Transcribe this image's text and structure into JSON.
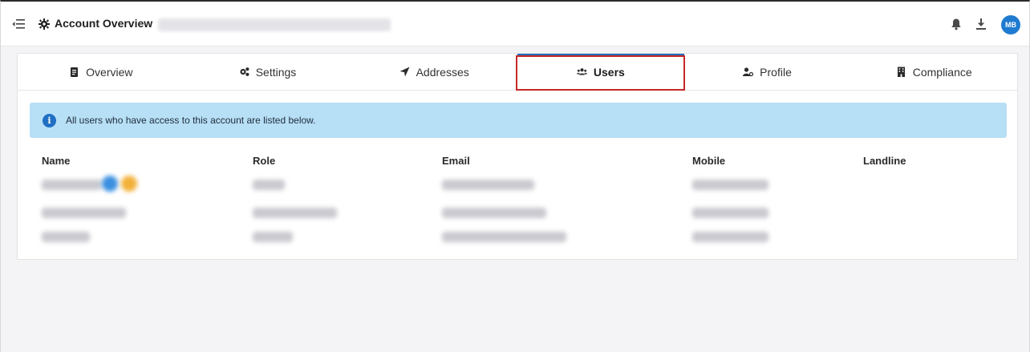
{
  "header": {
    "title": "Account Overview",
    "avatar_initials": "MB",
    "icons": [
      "menu-collapse-icon",
      "gear-icon",
      "bell-icon",
      "download-icon"
    ]
  },
  "tabs": [
    {
      "label": "Overview",
      "icon": "clipboard-icon"
    },
    {
      "label": "Settings",
      "icon": "cogs-icon"
    },
    {
      "label": "Addresses",
      "icon": "location-arrow-icon"
    },
    {
      "label": "Users",
      "icon": "users-icon",
      "active": true
    },
    {
      "label": "Profile",
      "icon": "user-profile-icon"
    },
    {
      "label": "Compliance",
      "icon": "building-icon"
    }
  ],
  "info": {
    "text": "All users who have access to this account are listed below."
  },
  "table": {
    "columns": [
      "Name",
      "Role",
      "Email",
      "Mobile",
      "Landline"
    ]
  },
  "colors": {
    "accent": "#1e6fb8",
    "banner": "#b7dff6",
    "highlight": "#c62828",
    "avatar": "#1f7bd1"
  }
}
